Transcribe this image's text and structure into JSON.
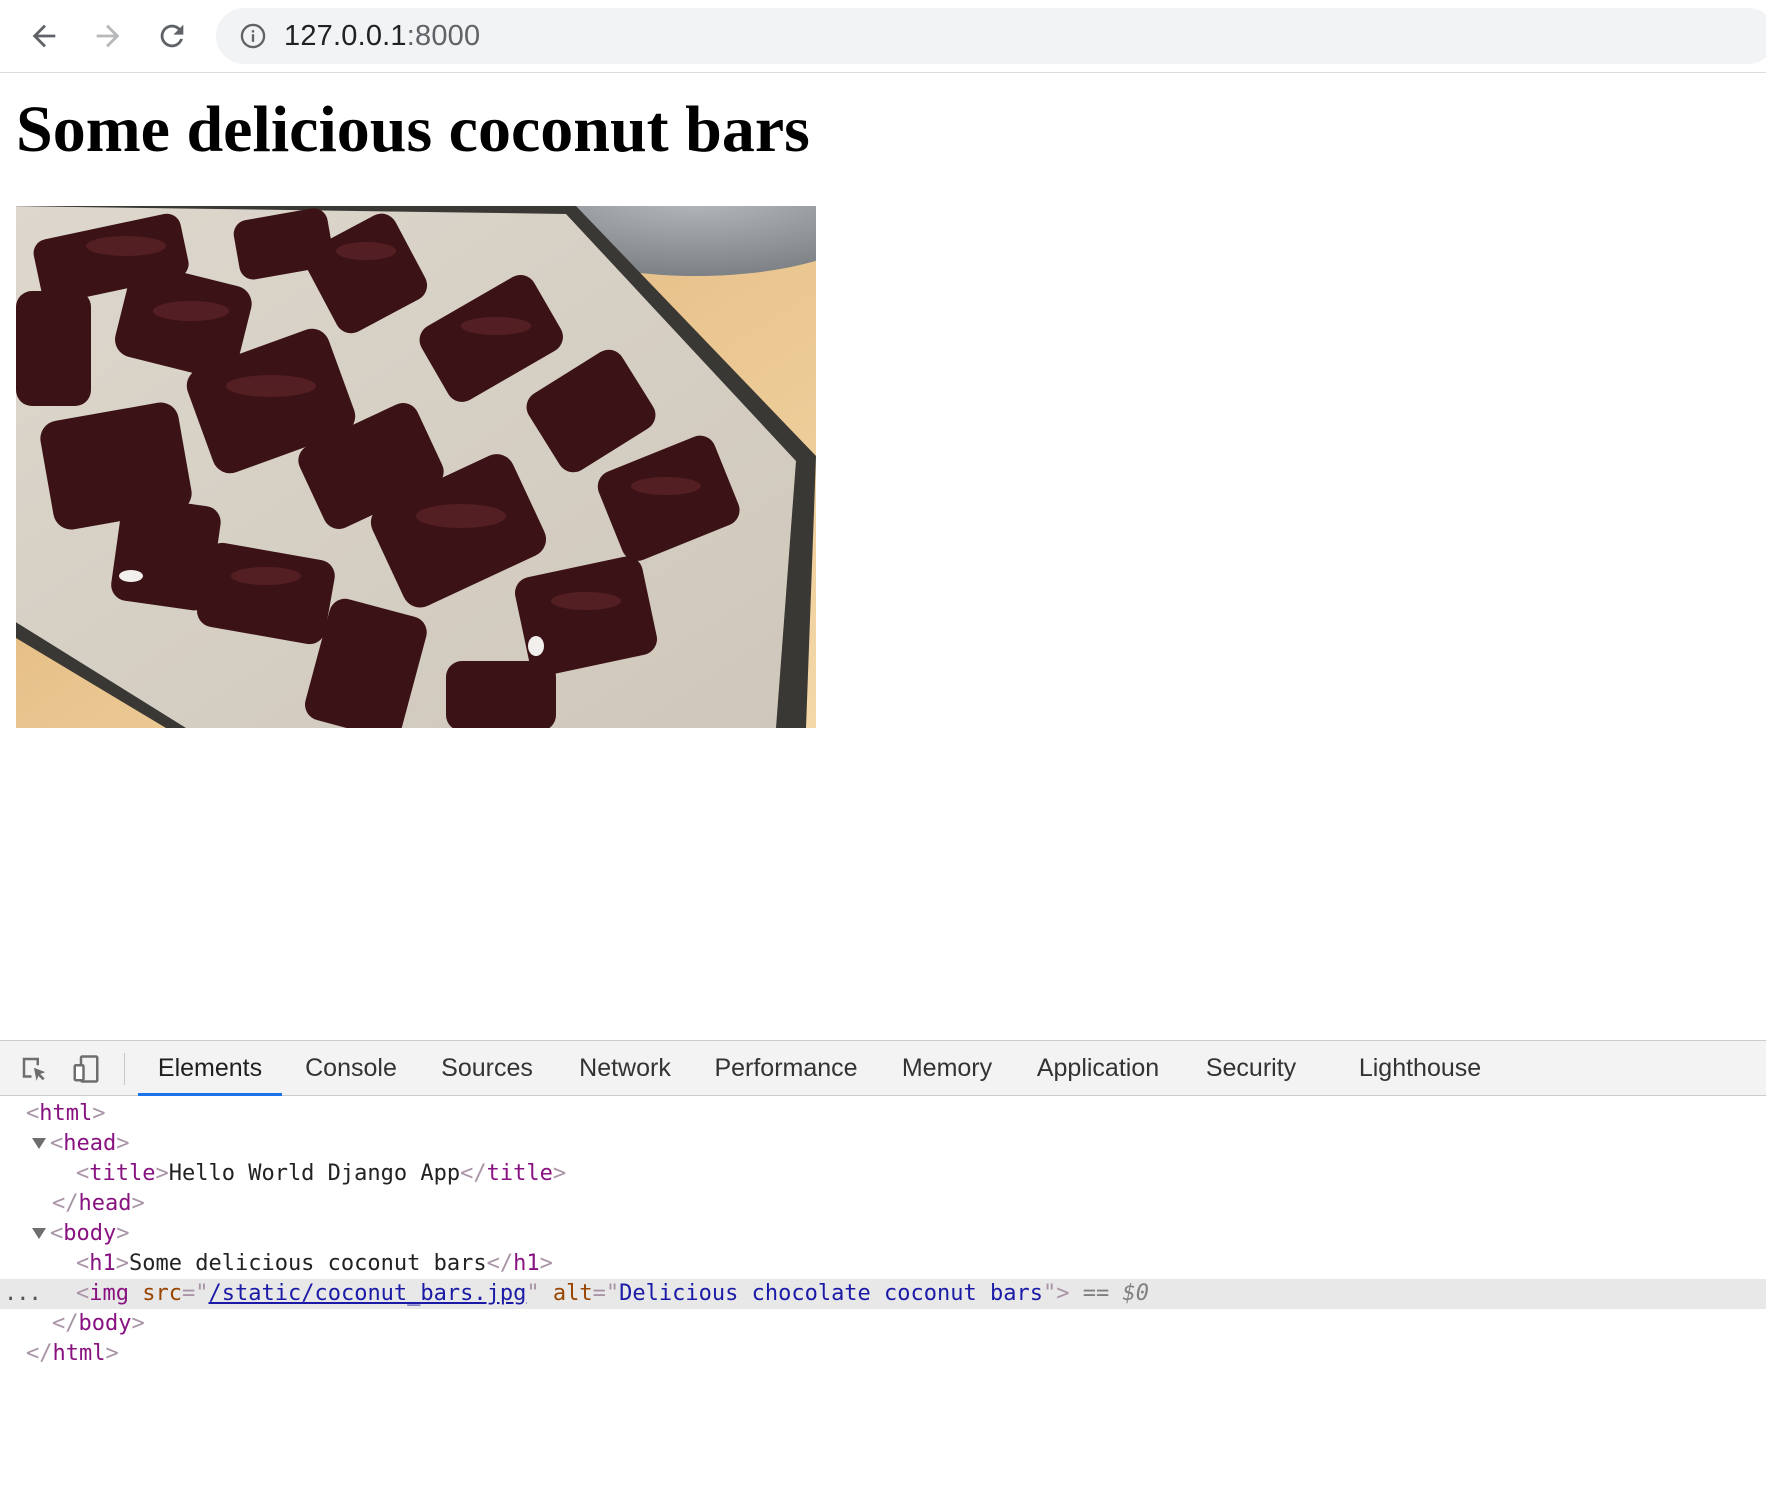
{
  "browser": {
    "url_host": "127.0.0.1",
    "url_port": ":8000"
  },
  "page": {
    "heading": "Some delicious coconut bars",
    "image_alt": "Delicious chocolate coconut bars"
  },
  "devtools": {
    "tabs": [
      "Elements",
      "Console",
      "Sources",
      "Network",
      "Performance",
      "Memory",
      "Application",
      "Security",
      "Lighthouse"
    ],
    "active_tab": "Elements",
    "tree": {
      "title_text": "Hello World Django App",
      "h1_text": "Some delicious coconut bars",
      "img_src": "/static/coconut_bars.jpg",
      "img_alt": "Delicious chocolate coconut bars",
      "selected_marker": "== $0",
      "ellipsis": "..."
    }
  },
  "colors": {
    "tab_underline": "#1a73e8",
    "tag": "#881280",
    "attr_name": "#994500",
    "attr_value": "#1a1aa6"
  }
}
